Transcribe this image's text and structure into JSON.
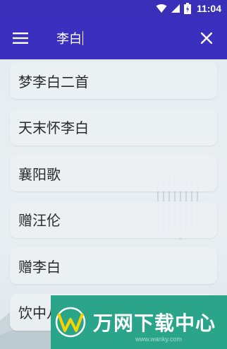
{
  "status_bar": {
    "time": "11:04",
    "icons": [
      "wifi-icon",
      "signal-icon",
      "battery-icon"
    ]
  },
  "app_bar": {
    "menu_icon": "menu-icon",
    "search_value": "李白",
    "close_icon": "close-icon"
  },
  "results": [
    "梦李白二首",
    "天末怀李白",
    "襄阳歌",
    "赠汪伦",
    "赠李白",
    "饮中八仙歌"
  ],
  "watermark": {
    "text": "万网下载中心",
    "url": "www.wanky.com"
  },
  "colors": {
    "app_bar": "#3a2fbf",
    "status_bar": "#3a2fb8",
    "watermark": "#2aa58a"
  }
}
